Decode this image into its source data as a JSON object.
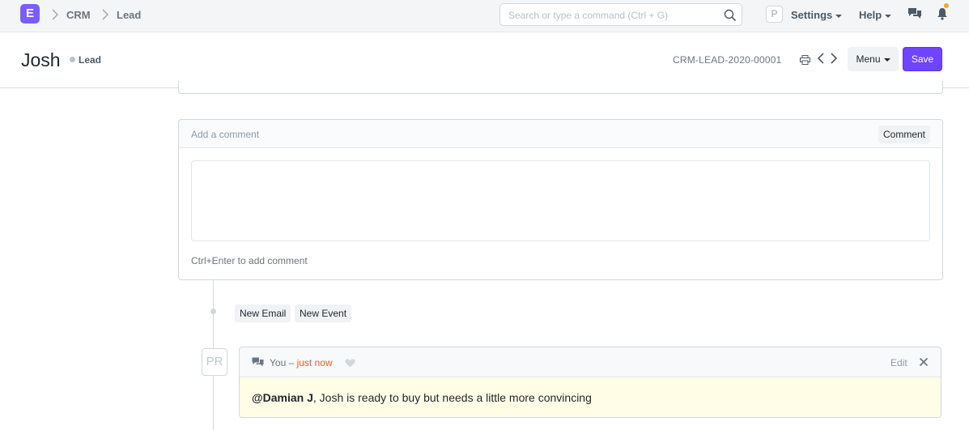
{
  "navbar": {
    "logo_letter": "E",
    "breadcrumbs": [
      "CRM",
      "Lead"
    ],
    "search_placeholder": "Search or type a command (Ctrl + G)",
    "user_initial": "P",
    "settings_label": "Settings",
    "help_label": "Help",
    "colors": {
      "accent": "#6e44ff",
      "logo": "#7c5cff",
      "notification": "#f5a623"
    }
  },
  "page_head": {
    "title": "Josh",
    "status": "Lead",
    "doc_name": "CRM-LEAD-2020-00001",
    "menu_label": "Menu",
    "save_label": "Save"
  },
  "comment_box": {
    "title": "Add a comment",
    "button_label": "Comment",
    "value": "",
    "hint": "Ctrl+Enter to add comment"
  },
  "timeline": {
    "actions": [
      "New Email",
      "New Event"
    ],
    "avatar_initials": "PR",
    "comment": {
      "author": "You",
      "separator": " – ",
      "time": "just now",
      "edit_label": "Edit",
      "mention": "@Damian J",
      "text": ", Josh is ready to buy but needs a little more convincing"
    }
  }
}
